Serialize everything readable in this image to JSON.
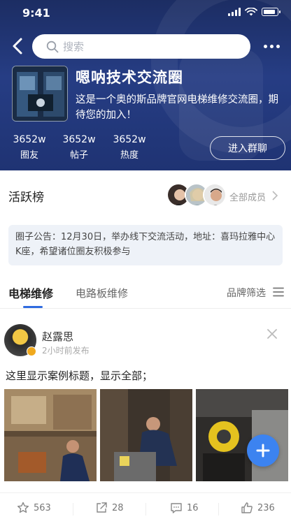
{
  "status_bar": {
    "time": "9:41"
  },
  "search": {
    "placeholder": "搜索"
  },
  "group": {
    "name": "嗯呐技术交流圈",
    "description": "这是一个奥的斯品牌官网电梯维修交流圈，期待您的加入！",
    "stats": [
      {
        "value": "3652w",
        "label": "圈友"
      },
      {
        "value": "3652w",
        "label": "帖子"
      },
      {
        "value": "3652w",
        "label": "热度"
      }
    ],
    "join_label": "进入群聊"
  },
  "active": {
    "title": "活跃榜",
    "all_members_label": "全部成员"
  },
  "notice": {
    "text": "圈子公告：12月30日，举办线下交流活动，地址：喜玛拉雅中心K座，希望诸位圈友积极参与"
  },
  "tabs": {
    "items": [
      "电梯维修",
      "电路板维修"
    ],
    "brand_filter_label": "品牌筛选"
  },
  "post": {
    "author": "赵露思",
    "time": "2小时前发布",
    "title": "这里显示案例标题，显示全部；",
    "actions": {
      "favorites": "563",
      "shares": "28",
      "comments": "16",
      "likes": "236"
    }
  },
  "colors": {
    "header_bg": "#243a7d",
    "accent": "#2f6be0",
    "fab": "#3c83f0"
  }
}
